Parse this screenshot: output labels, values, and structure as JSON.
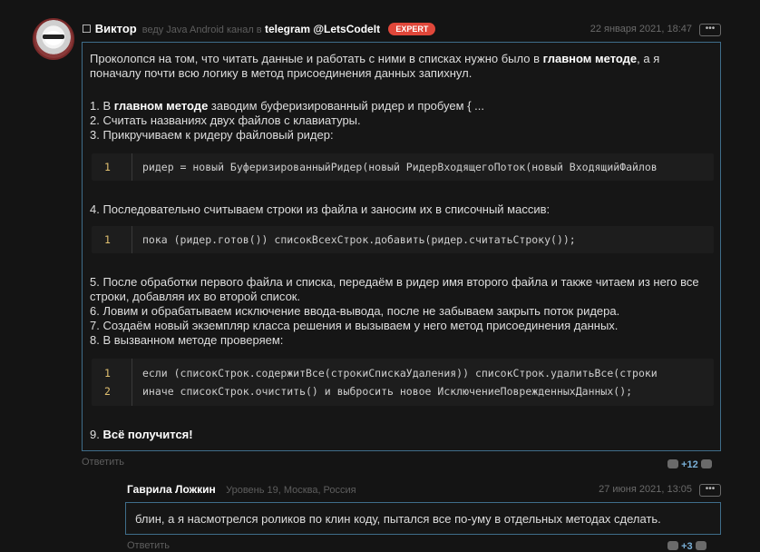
{
  "post": {
    "flag": "☐",
    "author": "Виктор",
    "meta_prefix": "веду Java Android канал в",
    "channel": "telegram @LetsCodeIt",
    "badge": "EXPERT",
    "date": "22 января 2021, 18:47",
    "menu": "•••",
    "intro_1": "Проколопся на том, что читать данные и работать с ними в списках нужно было в ",
    "intro_bold": "главном методе",
    "intro_2": ", а я поначалу почти всю логику в метод присоединения данных запихнул.",
    "step1_a": "1. В ",
    "step1_bold": "главном методе",
    "step1_b": " заводим буферизированный ридер и пробуем { ...",
    "step2": "2. Считать названиях двух файлов с клавиатуры.",
    "step3": "3. Прикручиваем к ридеру файловый ридер:",
    "code1": [
      {
        "n": "1",
        "src": "ридер = новый БуферизированныйРидер(новый РидерВходящегоПоток(новый ВходящийФайлов"
      }
    ],
    "step4": "4. Последовательно считываем строки из файла и заносим их в списочный массив:",
    "code2": [
      {
        "n": "1",
        "src": "пока (ридер.готов()) списокВсехСтрок.добавить(ридер.считатьСтроку());"
      }
    ],
    "step5": "5. После обработки первого файла и списка, передаём в ридер имя второго файла и также читаем из него все строки, добавляя их во второй список.",
    "step6": "6. Ловим и обрабатываем исключение ввода-вывода, после не забываем закрыть поток ридера.",
    "step7": "7. Создаём новый экземпляр класса решения и вызываем у него метод присоединения данных.",
    "step8": "8. В вызванном методе проверяем:",
    "code3": [
      {
        "n": "1",
        "src": "если (списокСтрок.содержитВсе(строкиСпискаУдаления)) списокСтрок.удалитьВсе(строки"
      },
      {
        "n": "2",
        "src": "иначе списокСтрок.очистить() и выбросить новое ИсключениеПоврежденныхДанных();"
      }
    ],
    "step9_a": "9. ",
    "step9_bold": "Всё получится!",
    "reply": "Ответить",
    "votes": "+12"
  },
  "comment": {
    "author": "Гаврила Ложкин",
    "meta": "Уровень 19, Москва, Россия",
    "date": "27 июня 2021, 13:05",
    "menu": "•••",
    "text": "блин, а я насмотрелся роликов по клин коду, пытался все по-уму в отдельных методах сделать.",
    "reply": "Ответить",
    "votes": "+3"
  }
}
